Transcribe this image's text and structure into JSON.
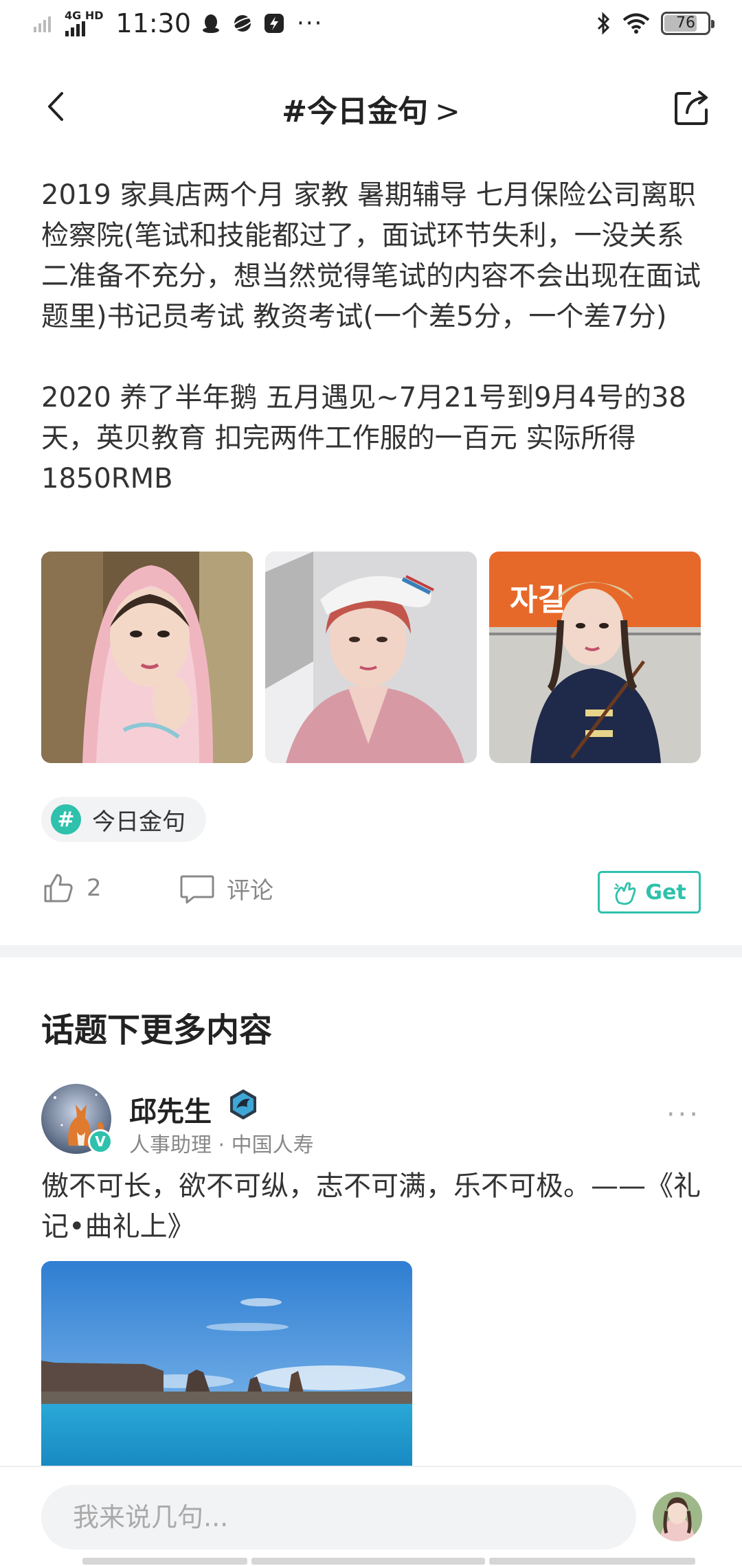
{
  "status_bar": {
    "network": "4G HD",
    "time": "11:30",
    "more": "···",
    "battery": "76",
    "battery_level": 0.76
  },
  "nav": {
    "title": "#今日金句",
    "title_chevron": ">"
  },
  "article": {
    "paragraph_1": "2019 家具店两个月  家教   暑期辅导 七月保险公司离职检察院(笔试和技能都过了，面试环节失利，一没关系二准备不充分，想当然觉得笔试的内容不会出现在面试题里)书记员考试 教资考试(一个差5分，一个差7分)",
    "paragraph_2": "2020 养了半年鹅 五月遇见~7月21号到9月4号的38天，英贝教育  扣完两件工作服的一百元 实际所得1850RMB",
    "photos": [
      {
        "icon": "woman-pink-scarf-photo"
      },
      {
        "icon": "woman-white-beret-photo"
      },
      {
        "icon": "woman-subway-sign-photo",
        "sign_text": "자길"
      }
    ],
    "topic": "今日金句",
    "likes": "2",
    "comment_label": "评论",
    "get_label": "Get"
  },
  "more_section": {
    "title": "话题下更多内容",
    "post": {
      "author": "邱先生",
      "meta": "人事助理 · 中国人寿",
      "verified": "V",
      "more": "···",
      "text": "傲不可长，欲不可纵，志不可满，乐不可极。——《礼记•曲礼上》",
      "image_icon": "lake-landscape-photo"
    }
  },
  "bottom_bar": {
    "input_placeholder": "我来说几句..."
  },
  "colors": {
    "accent": "#2ec1ac",
    "text": "#333333",
    "muted": "#888888",
    "chip_bg": "#f2f3f5"
  }
}
